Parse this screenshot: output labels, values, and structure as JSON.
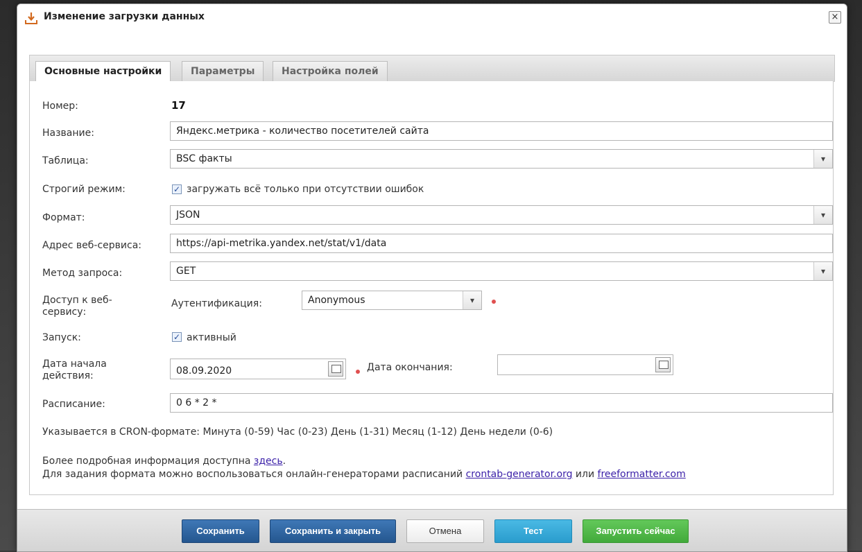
{
  "dialog": {
    "title": "Изменение загрузки данных",
    "close_glyph": "×",
    "icon": "download-icon"
  },
  "tabs": [
    {
      "label": "Основные настройки",
      "active": true
    },
    {
      "label": "Параметры",
      "active": false
    },
    {
      "label": "Настройка полей",
      "active": false
    }
  ],
  "form": {
    "number_label": "Номер:",
    "number_value": "17",
    "name_label": "Название:",
    "name_value": "Яндекс.метрика - количество посетителей сайта",
    "table_label": "Таблица:",
    "table_value": "BSC факты",
    "strict_label": "Строгий режим:",
    "strict_checked": true,
    "strict_text": "загружать всё только при отсутствии ошибок",
    "format_label": "Формат:",
    "format_value": "JSON",
    "url_label": "Адрес веб-сервиса:",
    "url_value": "https://api-metrika.yandex.net/stat/v1/data",
    "method_label": "Метод запроса:",
    "method_value": "GET",
    "access_label": "Доступ к веб-сервису:",
    "auth_label": "Аутентификация:",
    "auth_value": "Anonymous",
    "run_label": "Запуск:",
    "run_checked": true,
    "run_text": "активный",
    "start_label": "Дата начала действия:",
    "start_value": "08.09.2020",
    "end_label": "Дата окончания:",
    "end_value": "",
    "schedule_label": "Расписание:",
    "schedule_value": "0 6 * 2 *",
    "cron_hint": "Указывается в CRON-формате: Минута (0-59) Час (0-23) День (1-31) Месяц (1-12) День недели (0-6)",
    "info_prefix": "Более подробная информация доступна ",
    "info_link": "здесь",
    "info_suffix": ".",
    "gen_prefix": "Для задания формата можно воспользоваться онлайн-генераторами расписаний ",
    "gen_link1": "crontab-generator.org",
    "gen_or": " или ",
    "gen_link2": "freeformatter.com",
    "check_glyph": "✓",
    "arrow_glyph": "▾"
  },
  "footer": {
    "save": "Сохранить",
    "save_close": "Сохранить и закрыть",
    "cancel": "Отмена",
    "test": "Тест",
    "run_now": "Запустить сейчас"
  },
  "colors": {
    "primary_button": "#2f66a3",
    "test_button": "#3aaedc",
    "run_button": "#4fb847",
    "required_dot": "#e05050",
    "link": "#3a1fa8"
  }
}
